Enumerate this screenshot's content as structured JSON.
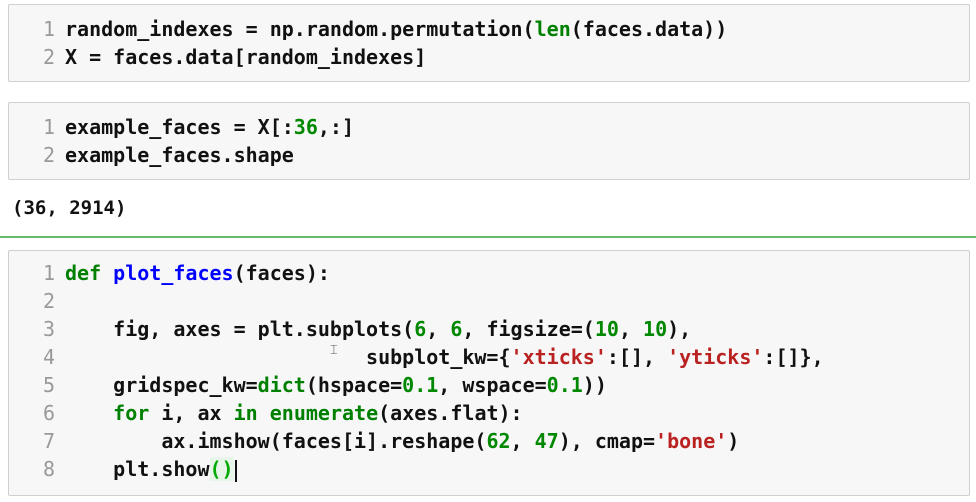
{
  "cells": [
    {
      "lines": [
        {
          "num": "1",
          "tokens": [
            {
              "t": "random_indexes = np.random.permutation(",
              "c": "p"
            },
            {
              "t": "len",
              "c": "b"
            },
            {
              "t": "(faces.data))",
              "c": "p"
            }
          ]
        },
        {
          "num": "2",
          "tokens": [
            {
              "t": "X = faces.data[random_indexes]",
              "c": "p"
            }
          ]
        }
      ]
    },
    {
      "lines": [
        {
          "num": "1",
          "tokens": [
            {
              "t": "example_faces = X[:",
              "c": "p"
            },
            {
              "t": "36",
              "c": "num"
            },
            {
              "t": ",:]",
              "c": "p"
            }
          ]
        },
        {
          "num": "2",
          "tokens": [
            {
              "t": "example_faces.shape",
              "c": "p"
            }
          ]
        }
      ],
      "output": "(36, 2914)"
    },
    {
      "lines": [
        {
          "num": "1",
          "tokens": [
            {
              "t": "def",
              "c": "k"
            },
            {
              "t": " ",
              "c": "p"
            },
            {
              "t": "plot_faces",
              "c": "n"
            },
            {
              "t": "(faces):",
              "c": "p"
            }
          ]
        },
        {
          "num": "2",
          "tokens": []
        },
        {
          "num": "3",
          "tokens": [
            {
              "t": "    fig, axes = plt.subplots(",
              "c": "p"
            },
            {
              "t": "6",
              "c": "num"
            },
            {
              "t": ", ",
              "c": "p"
            },
            {
              "t": "6",
              "c": "num"
            },
            {
              "t": ", figsize=(",
              "c": "p"
            },
            {
              "t": "10",
              "c": "num"
            },
            {
              "t": ", ",
              "c": "p"
            },
            {
              "t": "10",
              "c": "num"
            },
            {
              "t": "),",
              "c": "p"
            }
          ]
        },
        {
          "num": "4",
          "tokens": [
            {
              "t": "                         subplot_kw={",
              "c": "p"
            },
            {
              "t": "'xticks'",
              "c": "s"
            },
            {
              "t": ":[], ",
              "c": "p"
            },
            {
              "t": "'yticks'",
              "c": "s"
            },
            {
              "t": ":[]},",
              "c": "p"
            }
          ]
        },
        {
          "num": "5",
          "tokens": [
            {
              "t": "    gridspec_kw=",
              "c": "p"
            },
            {
              "t": "dict",
              "c": "b"
            },
            {
              "t": "(hspace=",
              "c": "p"
            },
            {
              "t": "0.1",
              "c": "num"
            },
            {
              "t": ", wspace=",
              "c": "p"
            },
            {
              "t": "0.1",
              "c": "num"
            },
            {
              "t": "))",
              "c": "p"
            }
          ]
        },
        {
          "num": "6",
          "tokens": [
            {
              "t": "    ",
              "c": "p"
            },
            {
              "t": "for",
              "c": "k"
            },
            {
              "t": " i, ax ",
              "c": "p"
            },
            {
              "t": "in",
              "c": "k"
            },
            {
              "t": " ",
              "c": "p"
            },
            {
              "t": "enumerate",
              "c": "b"
            },
            {
              "t": "(axes.flat):",
              "c": "p"
            }
          ]
        },
        {
          "num": "7",
          "tokens": [
            {
              "t": "        ax.imshow(faces[i].reshape(",
              "c": "p"
            },
            {
              "t": "62",
              "c": "num"
            },
            {
              "t": ", ",
              "c": "p"
            },
            {
              "t": "47",
              "c": "num"
            },
            {
              "t": "), cmap=",
              "c": "p"
            },
            {
              "t": "'bone'",
              "c": "s"
            },
            {
              "t": ")",
              "c": "p"
            }
          ]
        },
        {
          "num": "8",
          "tokens": [
            {
              "t": "    plt.show",
              "c": "p"
            },
            {
              "t": "()",
              "c": "match"
            }
          ],
          "cursor": true
        }
      ]
    }
  ],
  "mouse_glyph": "⌶"
}
